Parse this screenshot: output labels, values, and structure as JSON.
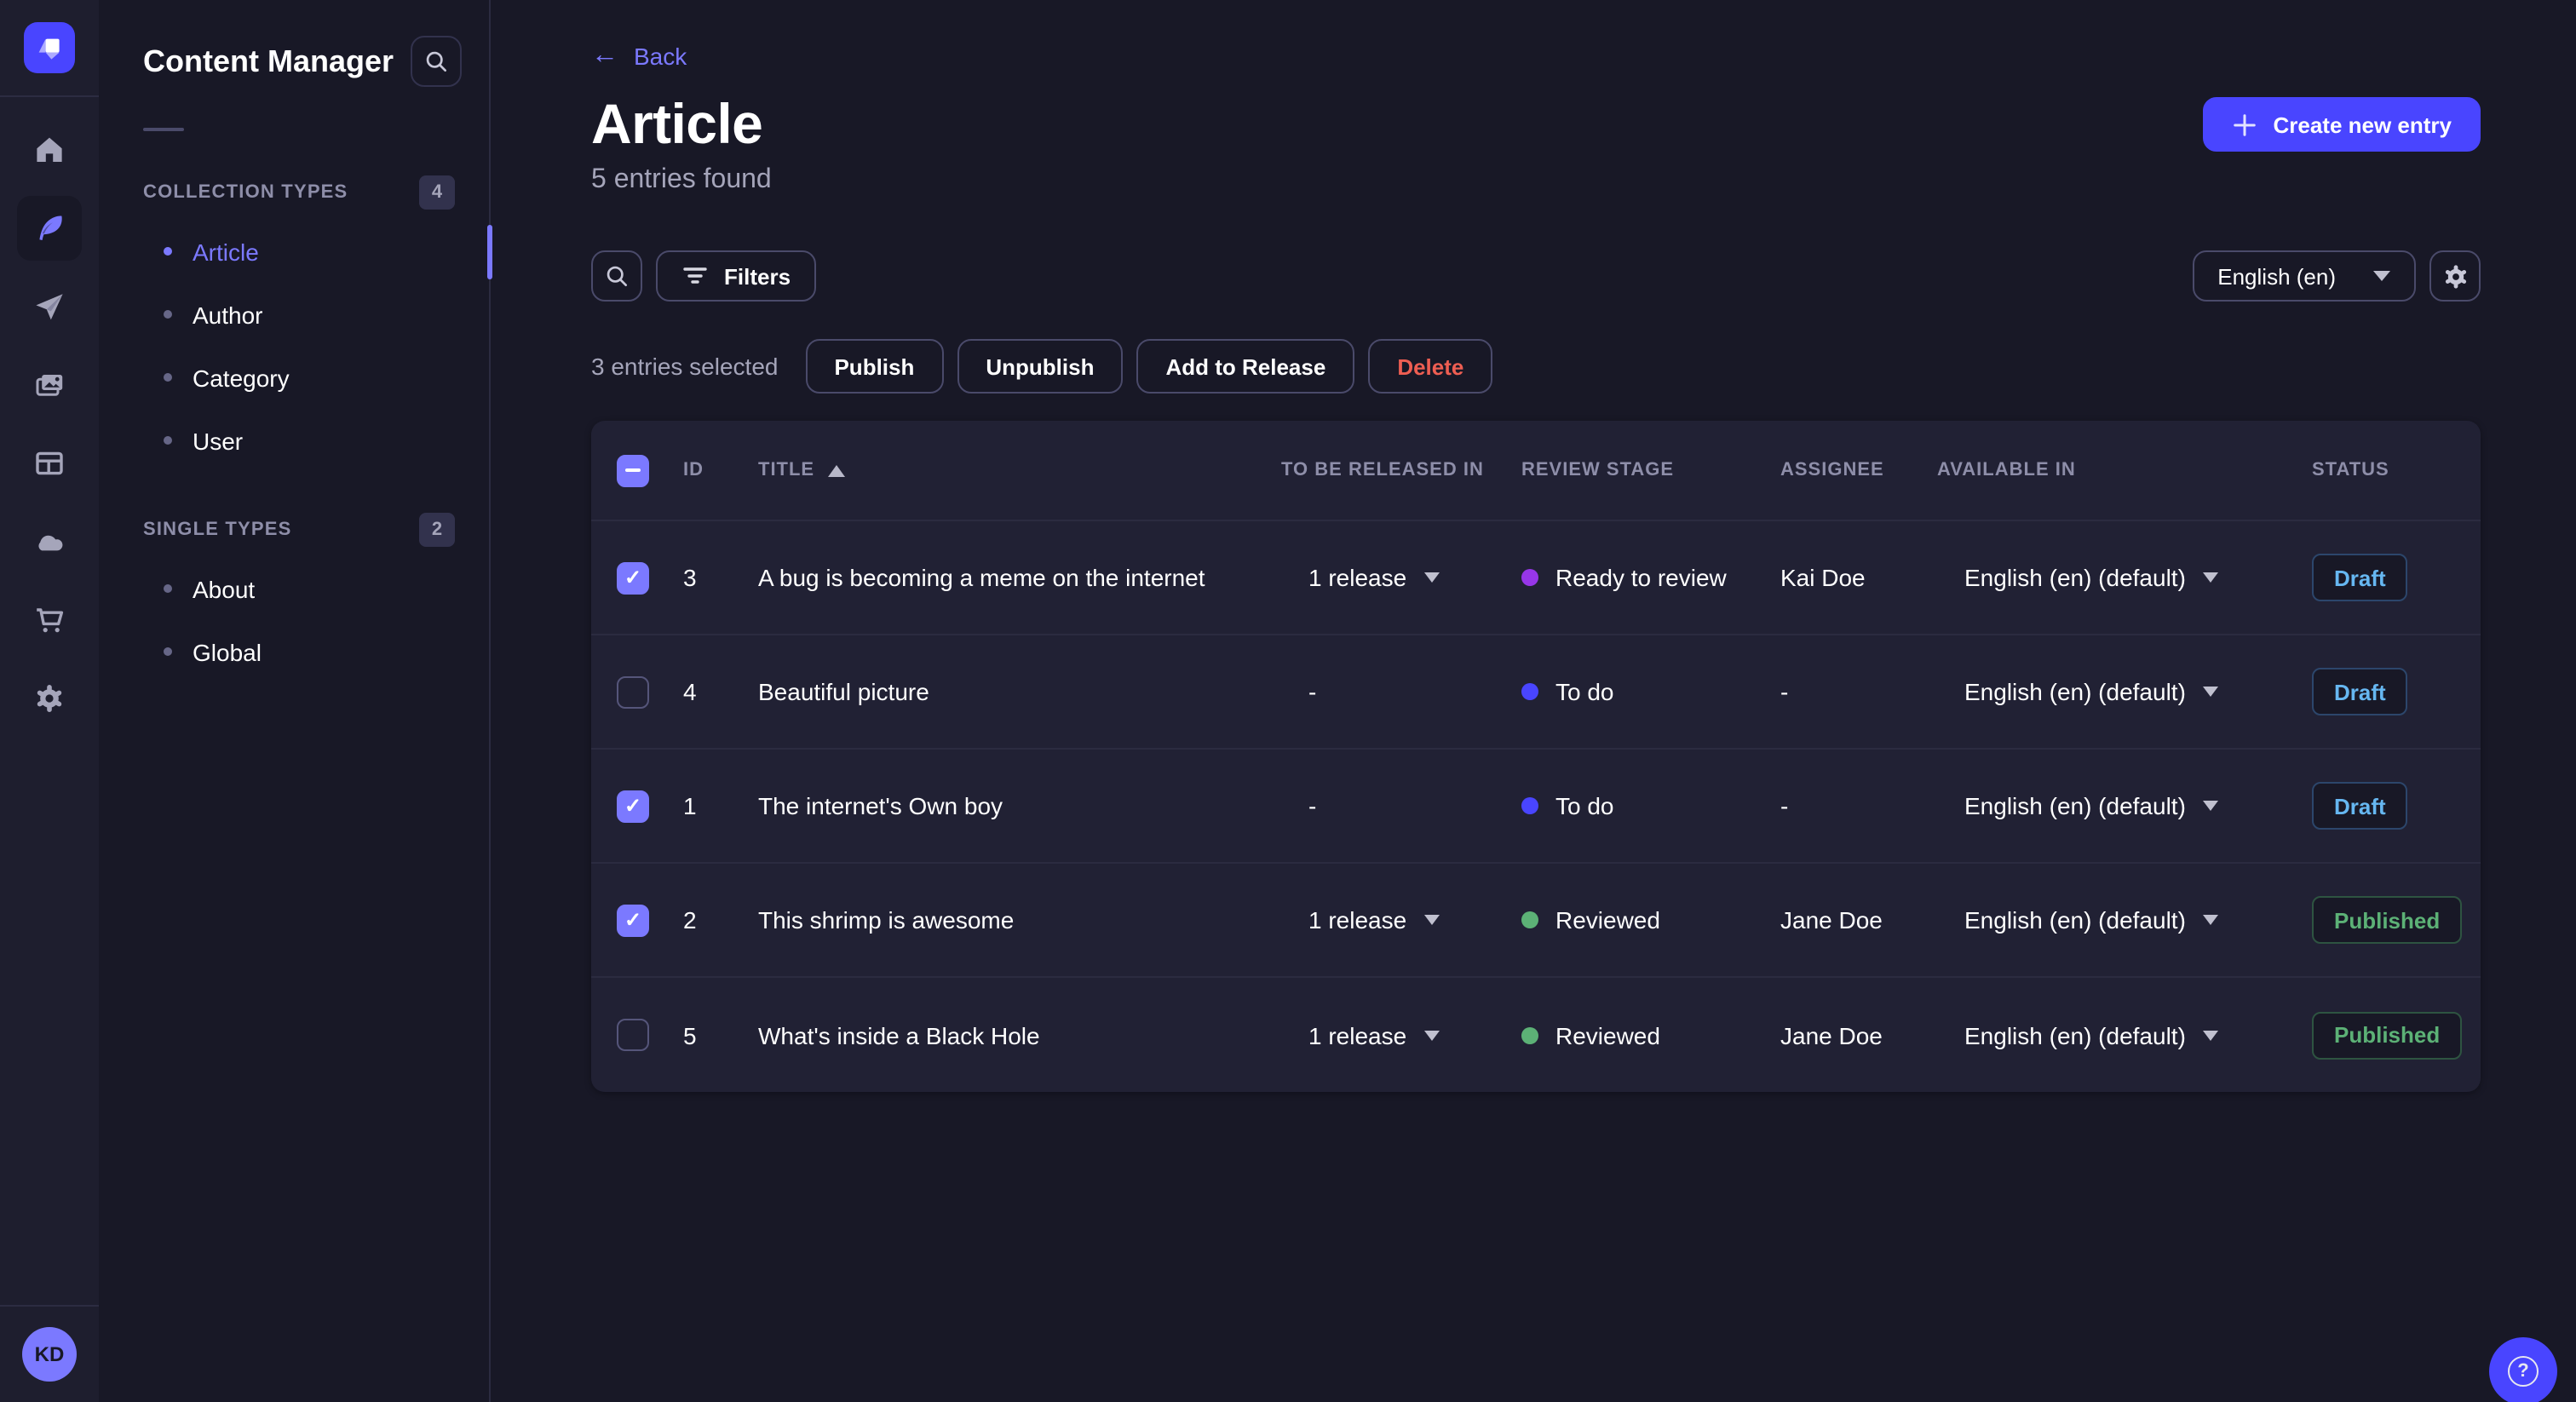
{
  "rail": {
    "icons": [
      "home",
      "content-manager",
      "releases",
      "media-library",
      "content-type-builder",
      "cloud",
      "marketplace",
      "settings"
    ],
    "active_icon": "content-manager",
    "avatar_initials": "KD"
  },
  "sidebar": {
    "title": "Content Manager",
    "sections": [
      {
        "label": "COLLECTION TYPES",
        "badge": "4",
        "items": [
          {
            "label": "Article",
            "active": true
          },
          {
            "label": "Author",
            "active": false
          },
          {
            "label": "Category",
            "active": false
          },
          {
            "label": "User",
            "active": false
          }
        ]
      },
      {
        "label": "SINGLE TYPES",
        "badge": "2",
        "items": [
          {
            "label": "About",
            "active": false
          },
          {
            "label": "Global",
            "active": false
          }
        ]
      }
    ]
  },
  "header": {
    "back_label": "Back",
    "title": "Article",
    "subtitle": "5 entries found",
    "create_label": "Create new entry"
  },
  "toolbar": {
    "filters_label": "Filters",
    "locale_value": "English (en)"
  },
  "selection": {
    "summary": "3 entries selected",
    "publish_label": "Publish",
    "unpublish_label": "Unpublish",
    "add_to_release_label": "Add to Release",
    "delete_label": "Delete"
  },
  "table": {
    "select_all": "indeterminate",
    "sort": {
      "column": "TITLE",
      "direction": "asc"
    },
    "columns": [
      "ID",
      "TITLE",
      "TO BE RELEASED IN",
      "REVIEW STAGE",
      "ASSIGNEE",
      "AVAILABLE IN",
      "STATUS"
    ],
    "rows": [
      {
        "selected": true,
        "id": "3",
        "title": "A bug is becoming a meme on the internet",
        "release": "1 release",
        "expandable": true,
        "stage": {
          "label": "Ready to review",
          "variant": "alternative"
        },
        "assignee": "Kai Doe",
        "locale": "English (en) (default)",
        "status": {
          "label": "Draft",
          "variant": "draft"
        }
      },
      {
        "selected": false,
        "id": "4",
        "title": "Beautiful picture",
        "release": "-",
        "expandable": false,
        "stage": {
          "label": "To do",
          "variant": "primary"
        },
        "assignee": "-",
        "locale": "English (en) (default)",
        "status": {
          "label": "Draft",
          "variant": "draft"
        }
      },
      {
        "selected": true,
        "id": "1",
        "title": "The internet's Own boy",
        "release": "-",
        "expandable": false,
        "stage": {
          "label": "To do",
          "variant": "primary"
        },
        "assignee": "-",
        "locale": "English (en) (default)",
        "status": {
          "label": "Draft",
          "variant": "draft"
        }
      },
      {
        "selected": true,
        "id": "2",
        "title": "This shrimp is awesome",
        "release": "1 release",
        "expandable": true,
        "stage": {
          "label": "Reviewed",
          "variant": "success"
        },
        "assignee": "Jane Doe",
        "locale": "English (en) (default)",
        "status": {
          "label": "Published",
          "variant": "published"
        }
      },
      {
        "selected": false,
        "id": "5",
        "title": "What's inside a Black Hole",
        "release": "1 release",
        "expandable": true,
        "stage": {
          "label": "Reviewed",
          "variant": "success"
        },
        "assignee": "Jane Doe",
        "locale": "English (en) (default)",
        "status": {
          "label": "Published",
          "variant": "published"
        }
      }
    ]
  },
  "colors": {
    "primary": "#4945ff",
    "primary_light": "#7b79ff",
    "danger": "#ee5e52",
    "success": "#5cb176",
    "draft_text": "#66b7f1",
    "stage_alternative": "#9736e8",
    "stage_primary": "#4945ff",
    "stage_success": "#5cb176",
    "page_bg": "#181826",
    "card_bg": "#212134"
  }
}
